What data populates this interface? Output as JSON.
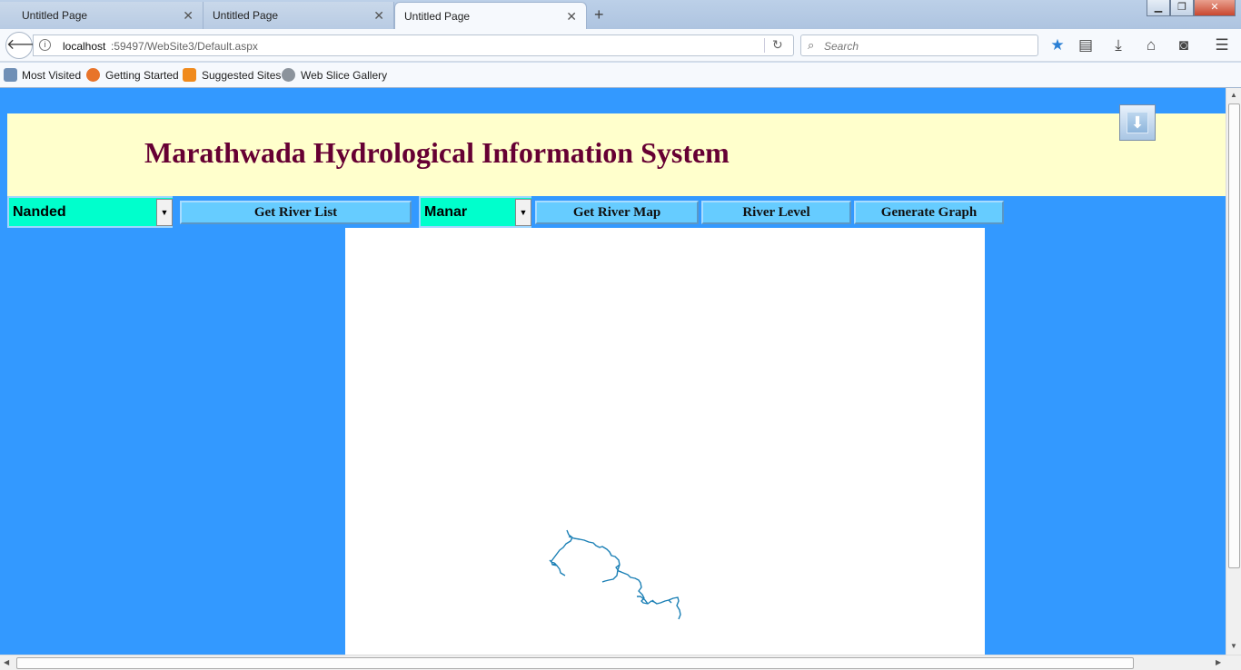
{
  "browser": {
    "tabs": [
      {
        "title": "Untitled Page",
        "active": false
      },
      {
        "title": "Untitled Page",
        "active": false
      },
      {
        "title": "Untitled Page",
        "active": true
      }
    ],
    "url_host": "localhost",
    "url_path": ":59497/WebSite3/Default.aspx",
    "search_placeholder": "Search",
    "bookmarks": [
      "Most Visited",
      "Getting Started",
      "Suggested Sites",
      "Web Slice Gallery"
    ],
    "icons": [
      "back-arrow-icon",
      "info-icon",
      "reload-icon",
      "search-icon",
      "star-icon",
      "reading-list-icon",
      "download-icon",
      "home-icon",
      "pocket-icon",
      "menu-icon"
    ]
  },
  "page": {
    "title": "Marathwada Hydrological Information System",
    "district_select": {
      "selected": "Nanded"
    },
    "get_river_list_label": "Get River List",
    "river_select": {
      "selected": "Manar"
    },
    "get_river_map_label": "Get  River Map",
    "river_level_label": "River Level",
    "generate_graph_label": "Generate Graph",
    "colors": {
      "page_background": "#3399ff",
      "banner_background": "#ffffcc",
      "title_color": "#660033",
      "dropdown_background": "#00ffcc",
      "button_background": "#66ccff",
      "river_line": "#1a7fb5"
    }
  }
}
